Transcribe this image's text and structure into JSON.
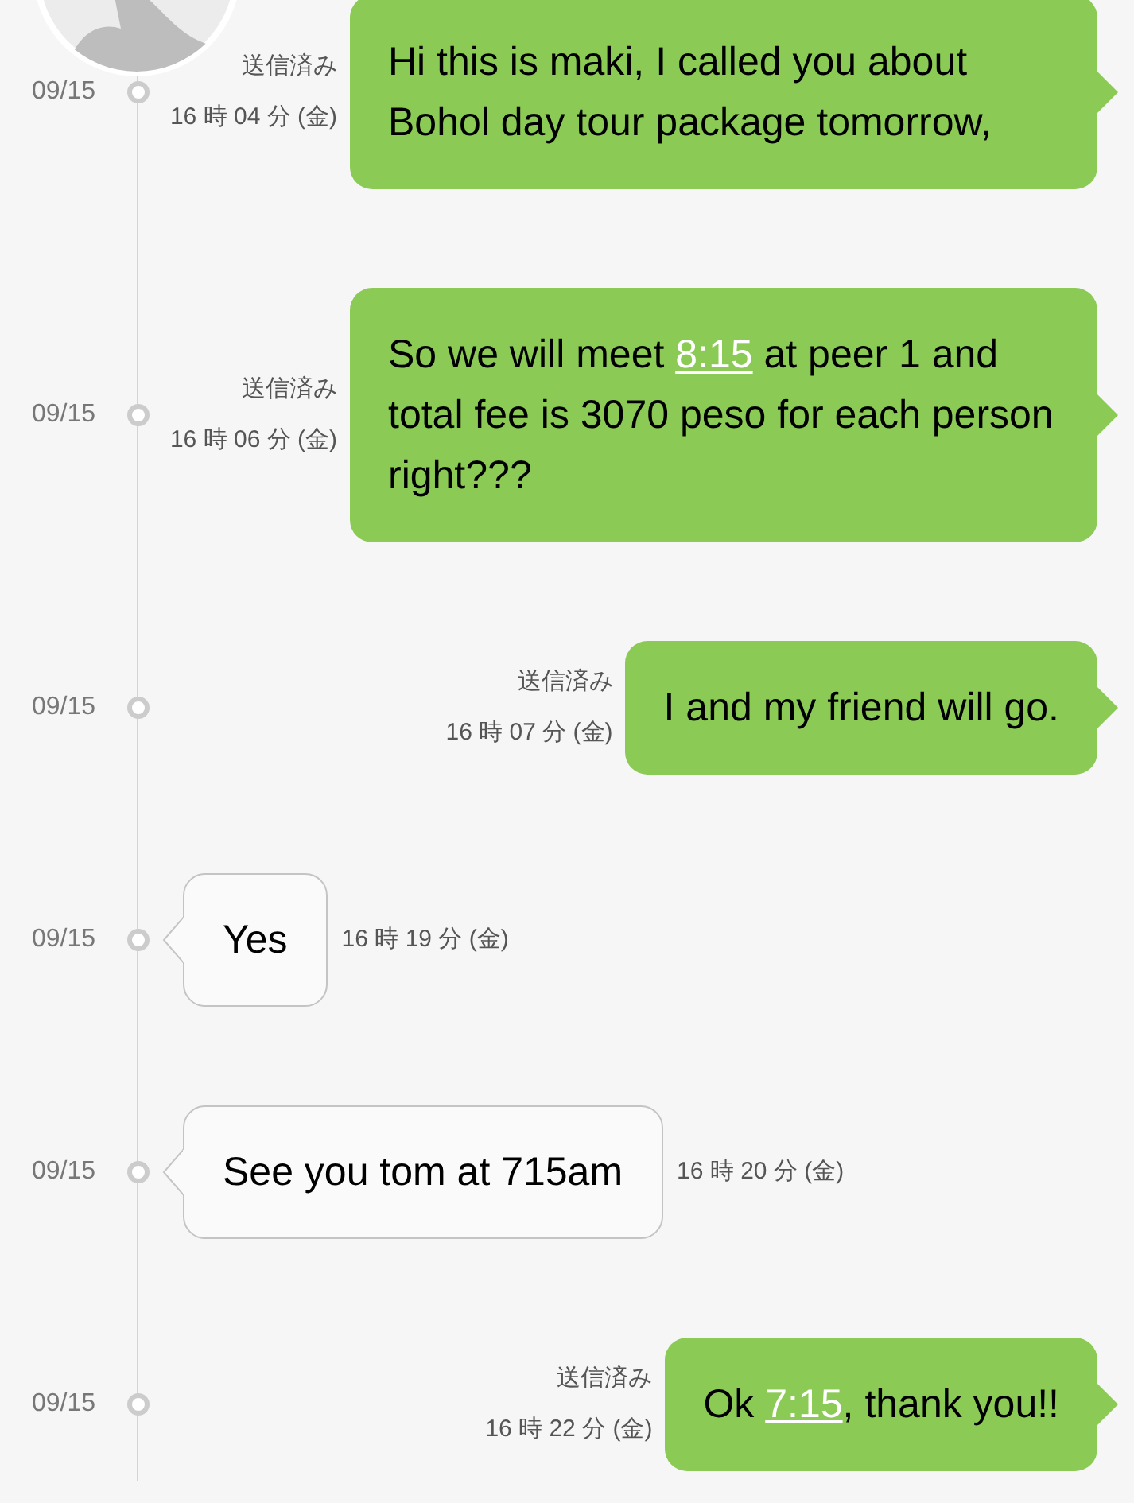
{
  "messages": [
    {
      "kind": "sent",
      "date": "09/15",
      "status": "送信済み",
      "time": "16 時 04 分 (金)",
      "parts": [
        {
          "kind": "text",
          "text": "Hi this is maki, I called you about Bohol day tour package tomorrow,"
        }
      ]
    },
    {
      "kind": "sent",
      "date": "09/15",
      "status": "送信済み",
      "time": "16 時 06 分 (金)",
      "parts": [
        {
          "kind": "text",
          "text": "So we will meet "
        },
        {
          "kind": "link",
          "text": "8:15"
        },
        {
          "kind": "text",
          "text": " at peer 1 and total fee is 3070 peso for each person right???"
        }
      ]
    },
    {
      "kind": "sent",
      "date": "09/15",
      "status": "送信済み",
      "time": "16 時 07 分 (金)",
      "parts": [
        {
          "kind": "text",
          "text": "I and my friend will go."
        }
      ]
    },
    {
      "kind": "received",
      "date": "09/15",
      "time": "16 時 19 分 (金)",
      "parts": [
        {
          "kind": "text",
          "text": "Yes"
        }
      ]
    },
    {
      "kind": "received",
      "date": "09/15",
      "time": "16 時 20 分 (金)",
      "parts": [
        {
          "kind": "text",
          "text": "See you tom at 715am"
        }
      ]
    },
    {
      "kind": "sent",
      "date": "09/15",
      "status": "送信済み",
      "time": "16 時 22 分 (金)",
      "parts": [
        {
          "kind": "text",
          "text": "Ok "
        },
        {
          "kind": "link",
          "text": "7:15"
        },
        {
          "kind": "text",
          "text": ", thank you!!"
        }
      ]
    }
  ]
}
